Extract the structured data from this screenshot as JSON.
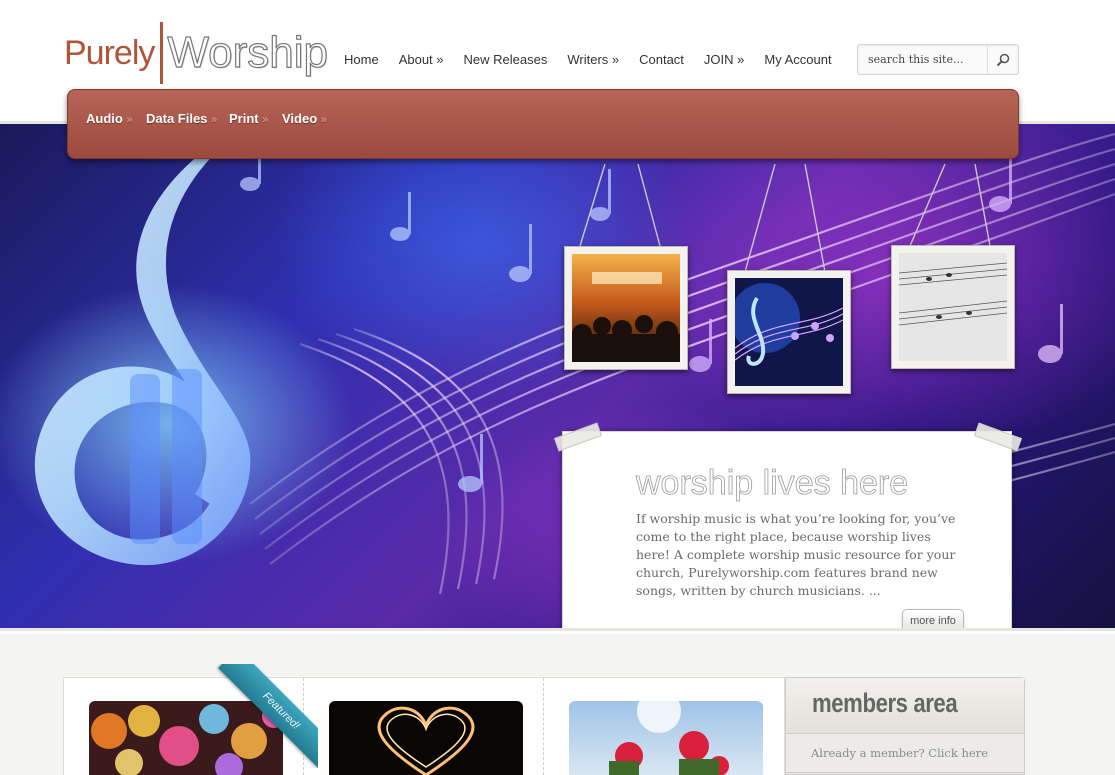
{
  "brand": {
    "name_part1": "Purely",
    "name_part2": "Worship"
  },
  "topnav": [
    {
      "label": "Home"
    },
    {
      "label": "About »"
    },
    {
      "label": "New Releases"
    },
    {
      "label": "Writers »"
    },
    {
      "label": "Contact"
    },
    {
      "label": "JOIN »"
    },
    {
      "label": "My Account"
    }
  ],
  "search": {
    "placeholder": "search this site...",
    "icon": "magnifier-icon"
  },
  "category_nav": [
    {
      "label": "Audio"
    },
    {
      "label": "Data Files"
    },
    {
      "label": "Print"
    },
    {
      "label": "Video"
    }
  ],
  "category_nav_arrow": "»",
  "hero": {
    "title": "worship lives here",
    "text": "If worship music is what you’re looking for, you’ve come to the right place, because worship lives here! A complete worship music resource for your church, Purelyworship.com features brand new songs, written by church musicians. ...",
    "more_label": "more info"
  },
  "featured": {
    "ribbon_label": "Featured!"
  },
  "members": {
    "title": "members area",
    "link": "Already a member? Click here"
  },
  "colors": {
    "accent": "#a9574a",
    "ribbon": "#2f93aa",
    "hero_blue": "#2f2fb0",
    "hero_purple": "#5a2aa8"
  }
}
